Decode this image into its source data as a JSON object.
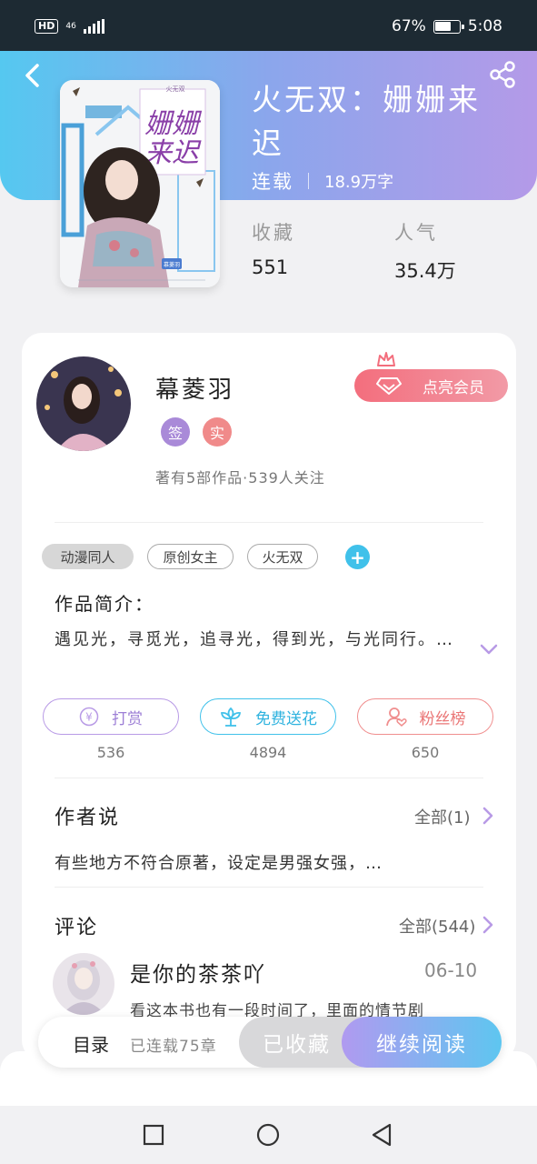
{
  "status_bar": {
    "hd": "HD",
    "network": "46",
    "battery_text": "67%",
    "battery_level": 0.67,
    "time": "5:08"
  },
  "book": {
    "title": "火无双：姗姗来迟",
    "status": "连载",
    "word_count": "18.9万字",
    "favorites_label": "收藏",
    "favorites_value": "551",
    "popularity_label": "人气",
    "popularity_value": "35.4万",
    "cover_title": "姗姗来迟",
    "cover_series": "火无双",
    "cover_author": "慕菱羽"
  },
  "author": {
    "name": "幕菱羽",
    "badge_signed": "签",
    "badge_verified": "实",
    "stats": "著有5部作品·539人关注",
    "vip_button": "点亮会员"
  },
  "tags": [
    "动漫同人",
    "原创女主",
    "火无双"
  ],
  "intro": {
    "label": "作品简介：",
    "text": "遇见光，寻觅光，追寻光，得到光，与光同行。…"
  },
  "actions": {
    "tip_label": "打赏",
    "tip_count": "536",
    "flower_label": "免费送花",
    "flower_count": "4894",
    "fans_label": "粉丝榜",
    "fans_count": "650"
  },
  "author_says": {
    "label": "作者说",
    "more": "全部(1)",
    "text": "有些地方不符合原著，设定是男强女强，…"
  },
  "comments": {
    "label": "评论",
    "more": "全部(544)",
    "items": [
      {
        "user": "是你的茶茶吖",
        "date": "06-10",
        "text": "看这本书也有一段时间了，里面的情节剧"
      }
    ]
  },
  "bottom_bar": {
    "toc_label": "目录",
    "toc_count": "已连载75章",
    "favorited_label": "已收藏",
    "continue_label": "继续阅读"
  },
  "colors": {
    "header_gradient": [
      "#55c8f0",
      "#b49ae8"
    ],
    "vip": "#f36e7d",
    "accent_blue": "#40c1ea",
    "accent_purple": "#b89ae6"
  },
  "icons": [
    "back-icon",
    "share-icon",
    "diamond-icon",
    "crown-icon",
    "plus-icon",
    "chevron-down-icon",
    "yen-icon",
    "flower-icon",
    "fans-icon",
    "chevron-right-icon",
    "square-icon",
    "circle-icon",
    "triangle-back-icon"
  ]
}
